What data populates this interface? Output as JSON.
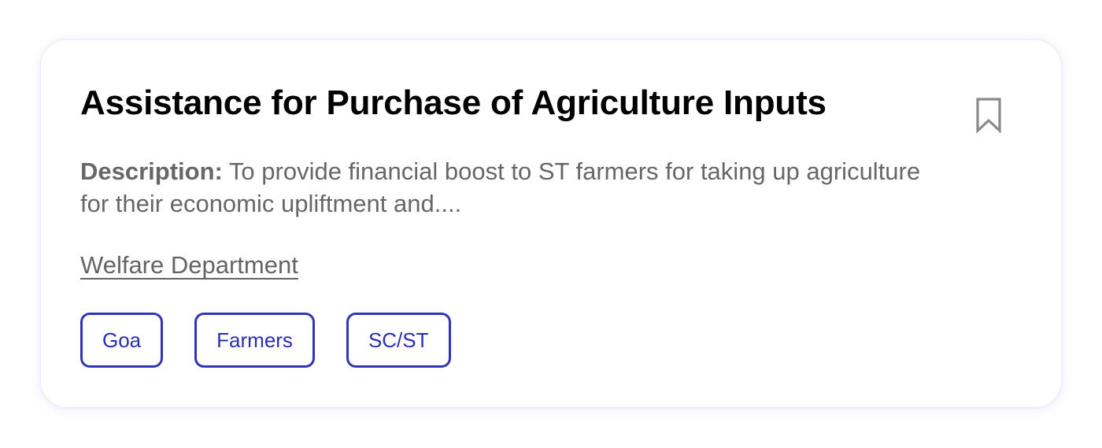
{
  "scheme": {
    "title": "Assistance for Purchase of Agriculture Inputs",
    "description_label": "Description:",
    "description_text": " To provide financial boost to ST farmers for taking up agriculture for their economic upliftment and....",
    "department": "Welfare Department",
    "tags": [
      "Goa",
      "Farmers",
      "SC/ST"
    ]
  },
  "icons": {
    "bookmark": "bookmark-outline-icon"
  },
  "colors": {
    "tag_accent": "#3034b8",
    "description_text": "#676767",
    "title_text": "#000000",
    "bookmark_stroke": "#8a8a8a"
  }
}
